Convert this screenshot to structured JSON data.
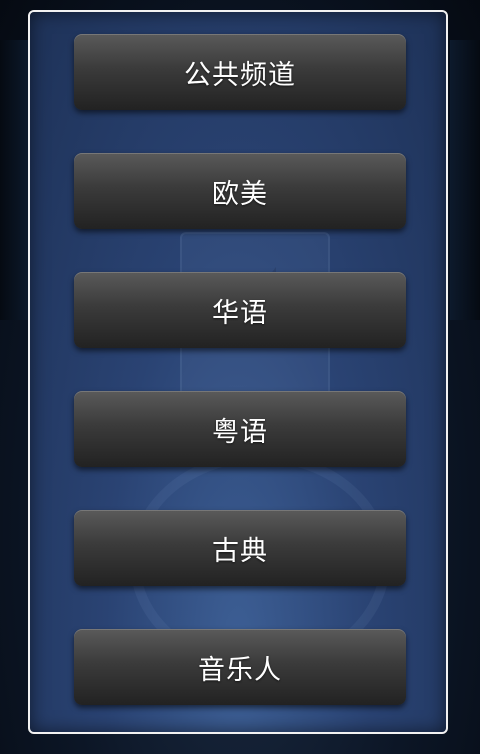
{
  "channel_dialog": {
    "buttons": [
      {
        "label": "公共频道"
      },
      {
        "label": "欧美"
      },
      {
        "label": "华语"
      },
      {
        "label": "粤语"
      },
      {
        "label": "古典"
      },
      {
        "label": "音乐人"
      }
    ]
  },
  "colors": {
    "dialog_border": "#f2f2f2",
    "dialog_background": "#2a4373",
    "button_background": "#3b3b3b",
    "button_text": "#ffffff"
  }
}
